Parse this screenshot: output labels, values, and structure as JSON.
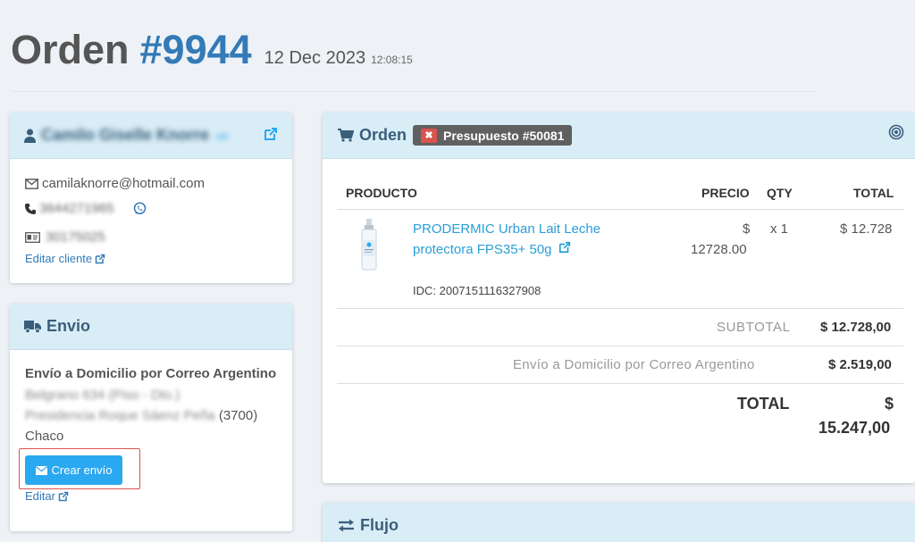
{
  "page": {
    "title": "Orden",
    "order_number": "#9944",
    "date": "12 Dec 2023",
    "time": "12:08:15"
  },
  "client": {
    "name": "Camilo Giselle Knorre",
    "name_suffix": "ue",
    "email": "camilaknorre@hotmail.com",
    "phone": "3644271965",
    "document": "30175025",
    "edit_link": "Editar cliente"
  },
  "envio": {
    "title": "Envio",
    "method": "Envío a Domicilio por Correo Argentino",
    "address_line1": "Belgrano 634 (Piso - Dto.)",
    "address_line2_blur": "Presidencia Roque Sáenz Peña",
    "address_zip": "(3700)",
    "province": "Chaco",
    "create_button": "Crear envío",
    "edit_link": "Editar"
  },
  "order": {
    "title": "Orden",
    "badge": "Presupuesto #50081",
    "columns": [
      "PRODUCTO",
      "PRECIO",
      "QTY",
      "TOTAL"
    ],
    "items": [
      {
        "name": "PRODERMIC Urban Lait Leche protectora FPS35+ 50g",
        "price_symbol": "$",
        "price": "12728.00",
        "qty": "x 1",
        "total": "$ 12.728",
        "idc": "IDC: 2007151116327908"
      }
    ],
    "subtotal_label": "SUBTOTAL",
    "subtotal_value": "$ 12.728,00",
    "shipping_label": "Envío a Domicilio por Correo Argentino",
    "shipping_value": "$ 2.519,00",
    "total_label": "TOTAL",
    "total_symbol": "$",
    "total_value": "15.247,00"
  },
  "flujo": {
    "title": "Flujo"
  },
  "colors": {
    "accent": "#337ab7",
    "panel_header": "#d9edf7",
    "button": "#2aa8f0",
    "danger": "#d9534f"
  }
}
